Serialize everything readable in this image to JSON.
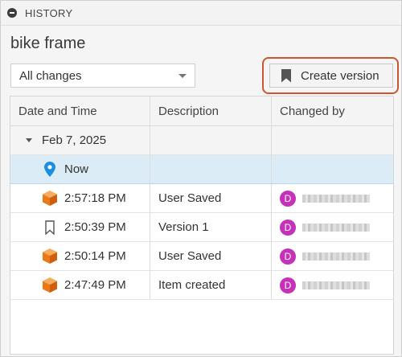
{
  "panel": {
    "title": "HISTORY"
  },
  "document": {
    "title": "bike frame"
  },
  "filter": {
    "selected": "All changes"
  },
  "toolbar": {
    "create_label": "Create version"
  },
  "table": {
    "columns": [
      "Date and Time",
      "Description",
      "Changed by"
    ],
    "group": {
      "label": "Feb 7, 2025"
    },
    "current": {
      "label": "Now"
    },
    "rows": [
      {
        "time": "2:57:18 PM",
        "description": "User Saved",
        "avatar": "D",
        "icon": "cube-icon"
      },
      {
        "time": "2:50:39 PM",
        "description": "Version 1",
        "avatar": "D",
        "icon": "bookmark-icon"
      },
      {
        "time": "2:50:14 PM",
        "description": "User Saved",
        "avatar": "D",
        "icon": "cube-icon"
      },
      {
        "time": "2:47:49 PM",
        "description": "Item created",
        "avatar": "D",
        "icon": "cube-icon"
      }
    ]
  },
  "colors": {
    "accent_highlight": "#c9582f",
    "avatar": "#c531b8",
    "selection": "#dcecf7",
    "pin": "#1a8ee0",
    "cube": "#f08a24"
  }
}
